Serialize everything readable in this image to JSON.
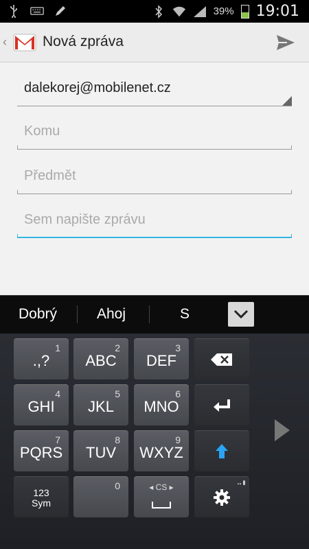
{
  "status_bar": {
    "battery": "39%",
    "time": "19:01"
  },
  "app": {
    "title": "Nová zpráva"
  },
  "compose": {
    "from_account": "dalekorej@mobilenet.cz",
    "to_placeholder": "Komu",
    "subject_placeholder": "Předmět",
    "body_placeholder": "Sem napište zprávu"
  },
  "suggestions": [
    "Dobrý",
    "Ahoj",
    "S"
  ],
  "keyboard": {
    "keys": [
      {
        "label": ".,?",
        "num": "1"
      },
      {
        "label": "ABC",
        "num": "2"
      },
      {
        "label": "DEF",
        "num": "3"
      },
      {
        "label": "GHI",
        "num": "4"
      },
      {
        "label": "JKL",
        "num": "5"
      },
      {
        "label": "MNO",
        "num": "6"
      },
      {
        "label": "PQRS",
        "num": "7"
      },
      {
        "label": "TUV",
        "num": "8"
      },
      {
        "label": "WXYZ",
        "num": "9"
      }
    ],
    "sym_label_1": "123",
    "sym_label_2": "Sym",
    "zero": "0",
    "language": "CS"
  },
  "colors": {
    "accent": "#33b5e5",
    "shift": "#2aa5f5"
  }
}
